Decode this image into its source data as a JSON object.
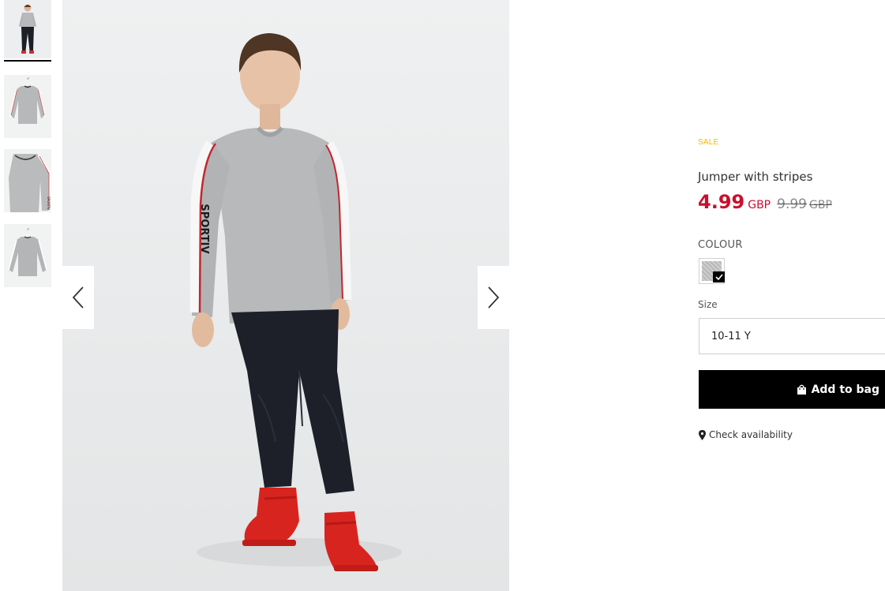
{
  "product": {
    "badge": "SALE",
    "title": "Jumper with stripes",
    "price_current": "4.99",
    "price_current_currency": "GBP",
    "price_old": "9.99",
    "price_old_currency": "GBP"
  },
  "colour": {
    "label": "COLOUR",
    "selected_swatch": "grey-melange"
  },
  "size": {
    "label": "Size",
    "selected": "10-11 Y"
  },
  "actions": {
    "add_to_bag": "Add to bag",
    "check_availability": "Check availability"
  },
  "gallery": {
    "thumbnail_count": 4,
    "active_index": 0,
    "icons": [
      "chevron-left-icon",
      "chevron-right-icon"
    ]
  },
  "colors": {
    "sale_badge": "#f5b800",
    "price_sale": "#c8102e",
    "button_bg": "#000000"
  }
}
